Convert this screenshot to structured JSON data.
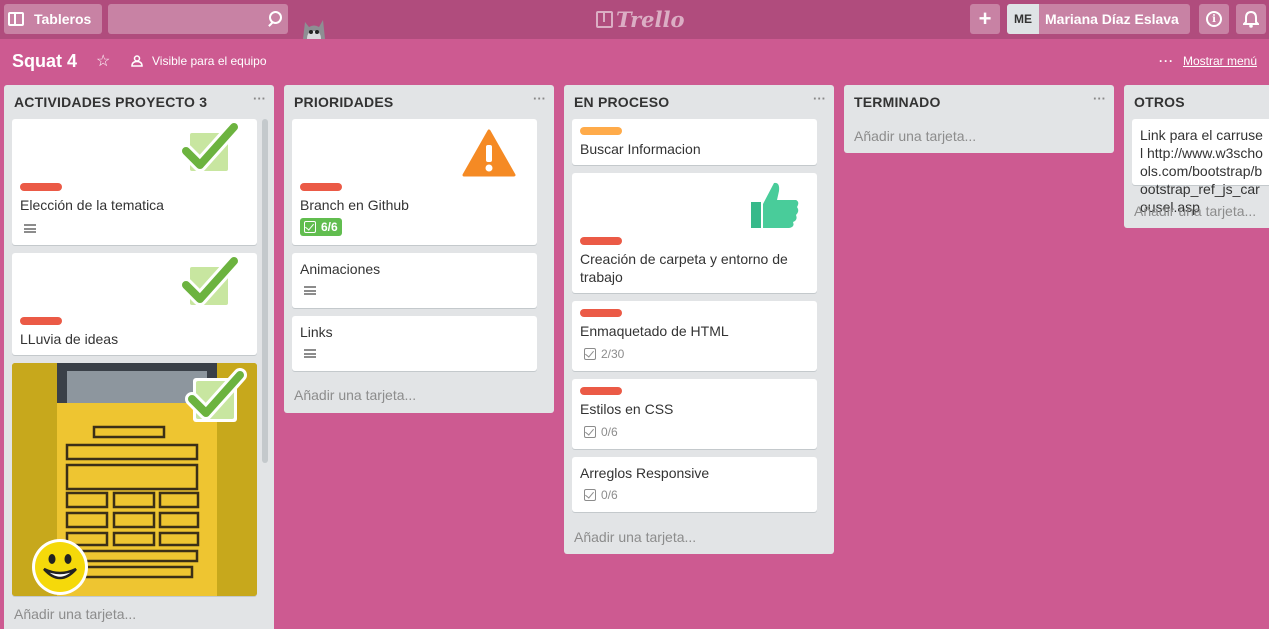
{
  "header": {
    "boards_label": "Tableros",
    "search_placeholder": "",
    "logo_text": "Trello",
    "member_initials": "ME",
    "member_name": "Mariana Díaz Eslava",
    "info_label": "i"
  },
  "board": {
    "title": "Squat 4",
    "visibility": "Visible para el equipo",
    "show_menu": "Mostrar menú"
  },
  "colors": {
    "background": "#cd5a91",
    "header": "#b04c7d",
    "label_red": "#eb5a46",
    "label_orange": "#ffab4a",
    "badge_green": "#61bd4f"
  },
  "lists": [
    {
      "title": "ACTIVIDADES PROYECTO 3",
      "cards": [
        {
          "title": "Elección de la tematica",
          "label": "red",
          "sticker": "check-icon",
          "description": true
        },
        {
          "title": "LLuvia de ideas",
          "label": "red",
          "sticker": "check-icon"
        },
        {
          "title": "",
          "cover": "paper-sketch-photo",
          "stickers": [
            "check-icon",
            "smiley-icon"
          ]
        }
      ],
      "add_card": "Añadir una tarjeta..."
    },
    {
      "title": "PRIORIDADES",
      "cards": [
        {
          "title": "Branch en Github",
          "label": "red",
          "sticker": "warning-icon",
          "checklist": "6/6"
        },
        {
          "title": "Animaciones",
          "description": true
        },
        {
          "title": "Links",
          "description": true
        }
      ],
      "add_card": "Añadir una tarjeta..."
    },
    {
      "title": "EN PROCESO",
      "cards": [
        {
          "title": "Buscar Informacion",
          "label": "orange"
        },
        {
          "title": "Creación de carpeta y entorno de trabajo",
          "label": "red",
          "sticker": "thumbs-up-icon"
        },
        {
          "title": "Enmaquetado de HTML",
          "label": "red",
          "checklist": "2/30"
        },
        {
          "title": "Estilos en CSS",
          "label": "red",
          "checklist": "0/6"
        },
        {
          "title": "Arreglos Responsive",
          "checklist": "0/6"
        }
      ],
      "add_card": "Añadir una tarjeta..."
    },
    {
      "title": "TERMINADO",
      "cards": [],
      "add_card": "Añadir una tarjeta..."
    },
    {
      "title": "OTROS",
      "cards": [
        {
          "title": "Link para el carrusel http://www.w3schools.com/bootstrap/bootstrap_ref_js_carousel.asp"
        }
      ],
      "add_card": "Añadir una tarjeta..."
    }
  ]
}
